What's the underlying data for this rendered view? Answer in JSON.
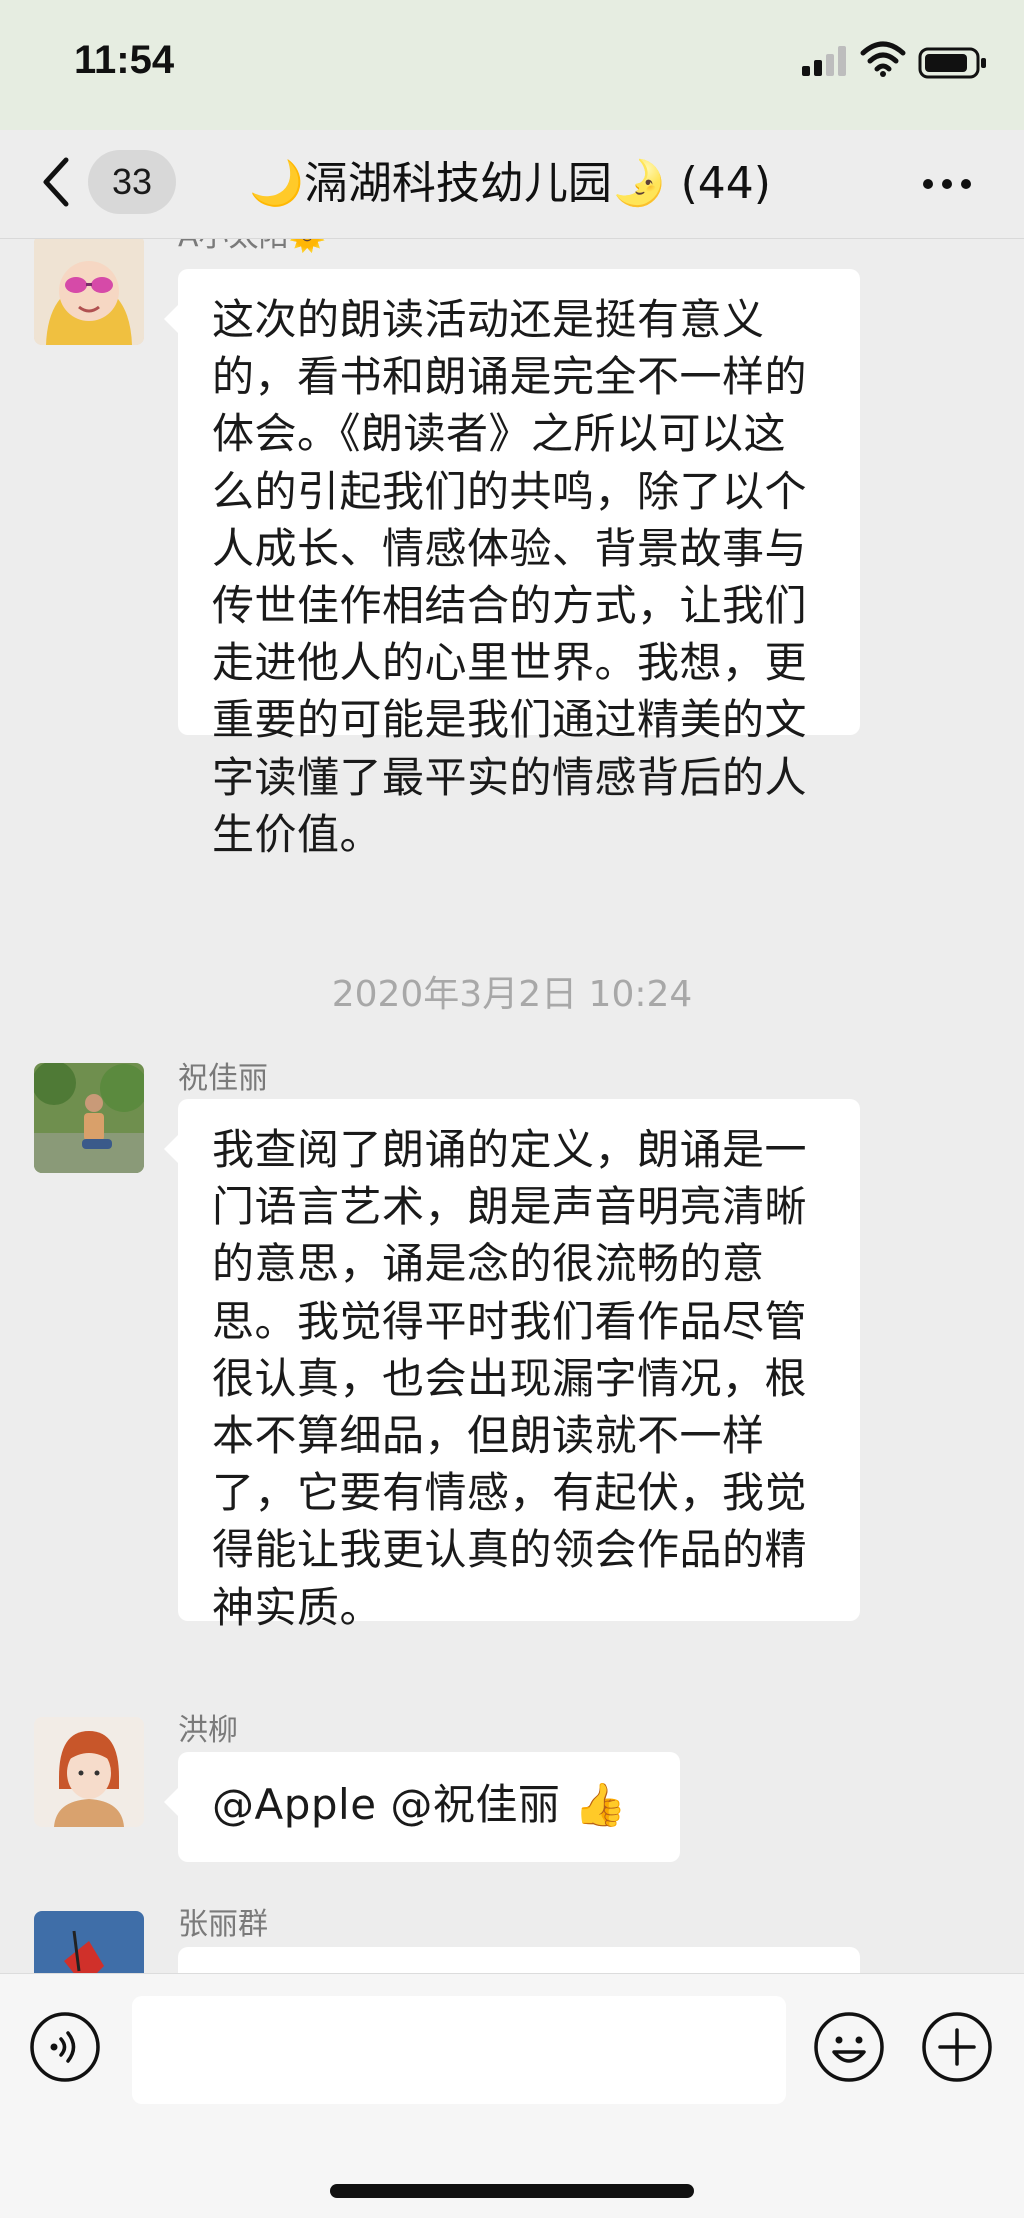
{
  "status_bar": {
    "time": "11:54"
  },
  "nav": {
    "unread_count": "33",
    "title": "🌙滆湖科技幼儿园🌛 (44)"
  },
  "messages": [
    {
      "sender": "A小太阳🌞",
      "text": "这次的朗读活动还是挺有意义的，看书和朗诵是完全不一样的体会。《朗读者》之所以可以这么的引起我们的共鸣，除了以个人成长、情感体验、背景故事与传世佳作相结合的方式，让我们走进他人的心里世界。我想，更重要的可能是我们通过精美的文字读懂了最平实的情感背后的人生价值。"
    },
    {
      "sender": "祝佳丽",
      "text": "我查阅了朗诵的定义，朗诵是一门语言艺术，朗是声音明亮清晰的意思，诵是念的很流畅的意思。我觉得平时我们看作品尽管很认真，也会出现漏字情况，根本不算细品，但朗读就不一样了，它要有情感，有起伏，我觉得能让我更认真的领会作品的精神实质。"
    },
    {
      "sender": "洪柳",
      "text": "@Apple @祝佳丽 👍"
    },
    {
      "sender": "张丽群",
      "text": ""
    }
  ],
  "timestamp": "2020年3月2日 10:24",
  "colors": {
    "background": "#ededed",
    "bubble": "#ffffff",
    "status_bar": "#e6ede1",
    "input_bar": "#f6f6f6",
    "secondary_text": "#7a7a7a"
  },
  "icons": [
    "signal-icon",
    "wifi-icon",
    "battery-icon",
    "back-icon",
    "more-icon",
    "voice-icon",
    "emoji-icon",
    "add-icon"
  ]
}
